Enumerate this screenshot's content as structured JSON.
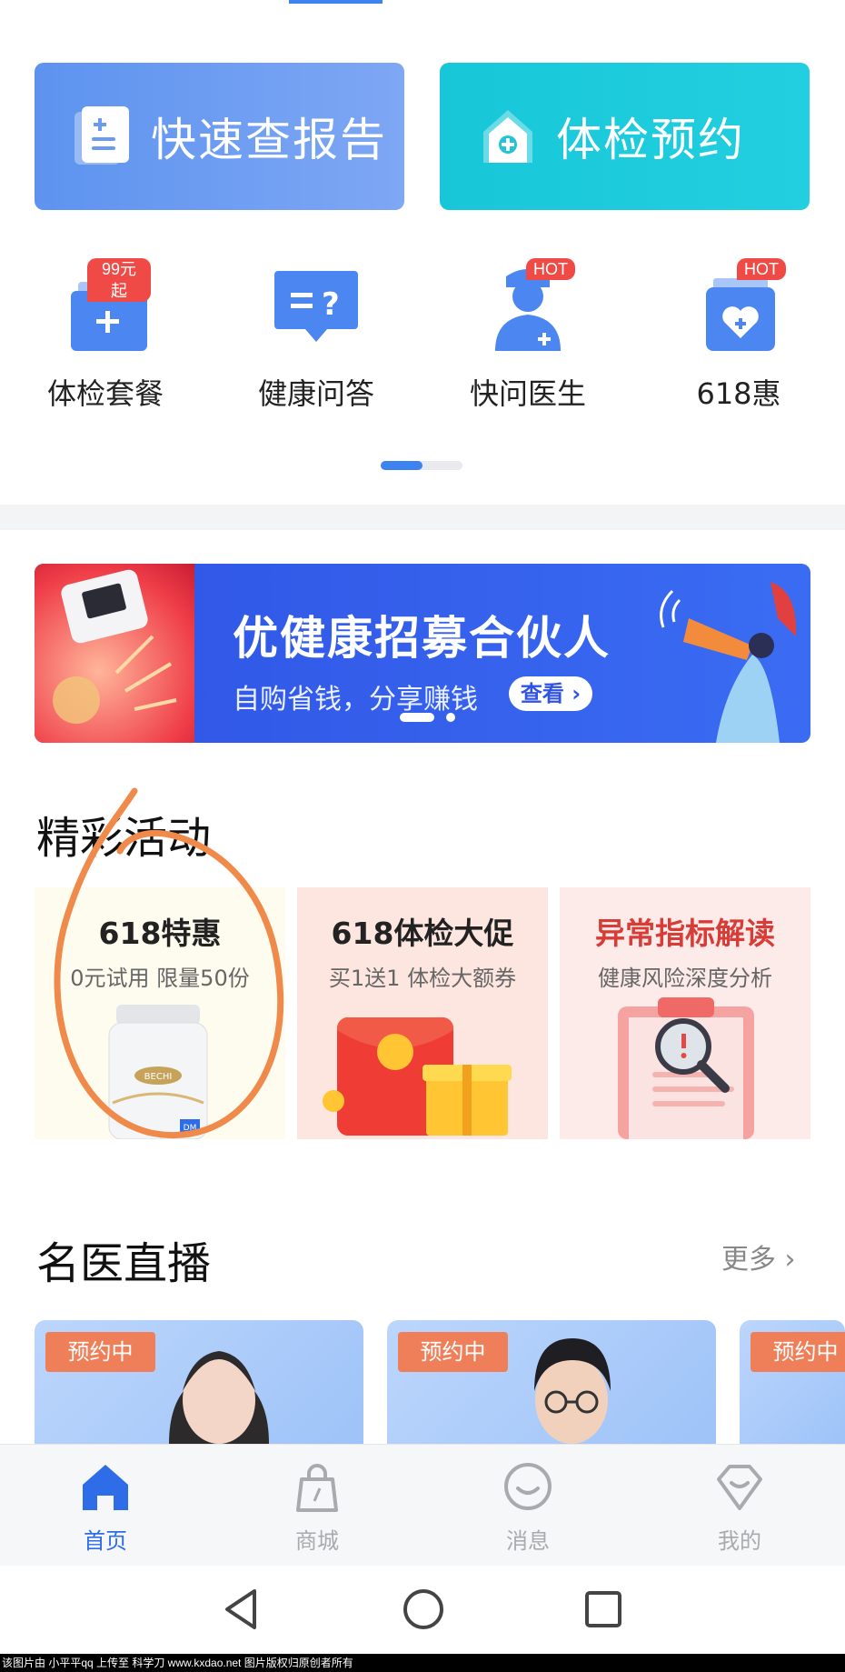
{
  "quick_actions": {
    "report_label": "快速查报告",
    "exam_booking_label": "体检预约"
  },
  "menu": [
    {
      "label": "体检套餐",
      "badge": "99元起",
      "icon": "package-icon"
    },
    {
      "label": "健康问答",
      "icon": "qa-icon"
    },
    {
      "label": "快问医生",
      "badge": "HOT",
      "icon": "doctor-icon"
    },
    {
      "label": "618惠",
      "badge": "HOT",
      "icon": "heart-box-icon"
    }
  ],
  "banner": {
    "title": "优健康招募合伙人",
    "subtitle": "自购省钱，分享赚钱",
    "button": "查看",
    "slide_count": 2,
    "active_slide": 1
  },
  "activities": {
    "title": "精彩活动",
    "cards": [
      {
        "title": "618特惠",
        "subtitle": "0元试用 限量50份",
        "product_brand": "BECHI",
        "product_mark": "DM"
      },
      {
        "title": "618体检大促",
        "subtitle": "买1送1 体检大额券"
      },
      {
        "title": "异常指标解读",
        "subtitle": "健康风险深度分析"
      }
    ]
  },
  "live": {
    "title": "名医直播",
    "more": "更多",
    "cards": [
      {
        "tag": "预约中"
      },
      {
        "tag": "预约中"
      },
      {
        "tag": "预约中"
      }
    ]
  },
  "tabbar": [
    {
      "label": "首页",
      "icon": "home-icon",
      "active": true
    },
    {
      "label": "商城",
      "icon": "shopping-bag-icon",
      "active": false
    },
    {
      "label": "消息",
      "icon": "message-icon",
      "active": false
    },
    {
      "label": "我的",
      "icon": "profile-icon",
      "active": false
    }
  ],
  "footer_credit": "该图片由 小平平qq 上传至 科学刀 www.kxdao.net 图片版权归原创者所有",
  "colors": {
    "primary": "#3e82f0",
    "teal": "#17c7d8",
    "badge": "#ef4a45",
    "tag": "#ef7f58",
    "annotation": "#ef8a4a"
  }
}
